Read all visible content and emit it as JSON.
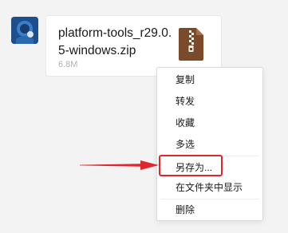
{
  "message": {
    "file_name": "platform-tools_r29.0.5-windows.zip",
    "file_size": "6.8M",
    "file_icon": "zip-archive-icon",
    "avatar_icon": "user-avatar"
  },
  "context_menu": {
    "items": [
      {
        "label": "复制"
      },
      {
        "label": "转发"
      },
      {
        "label": "收藏"
      },
      {
        "label": "多选"
      },
      {
        "label": "另存为..."
      },
      {
        "label": "在文件夹中显示"
      },
      {
        "label": "删除"
      }
    ],
    "highlighted_item": "另存为..."
  },
  "annotation": {
    "color": "#e0262c",
    "type": "red-arrow-pointing-right"
  },
  "colors": {
    "background": "#f3f3f3",
    "zip_brown": "#7a4a2b",
    "highlight": "#e0262c"
  }
}
